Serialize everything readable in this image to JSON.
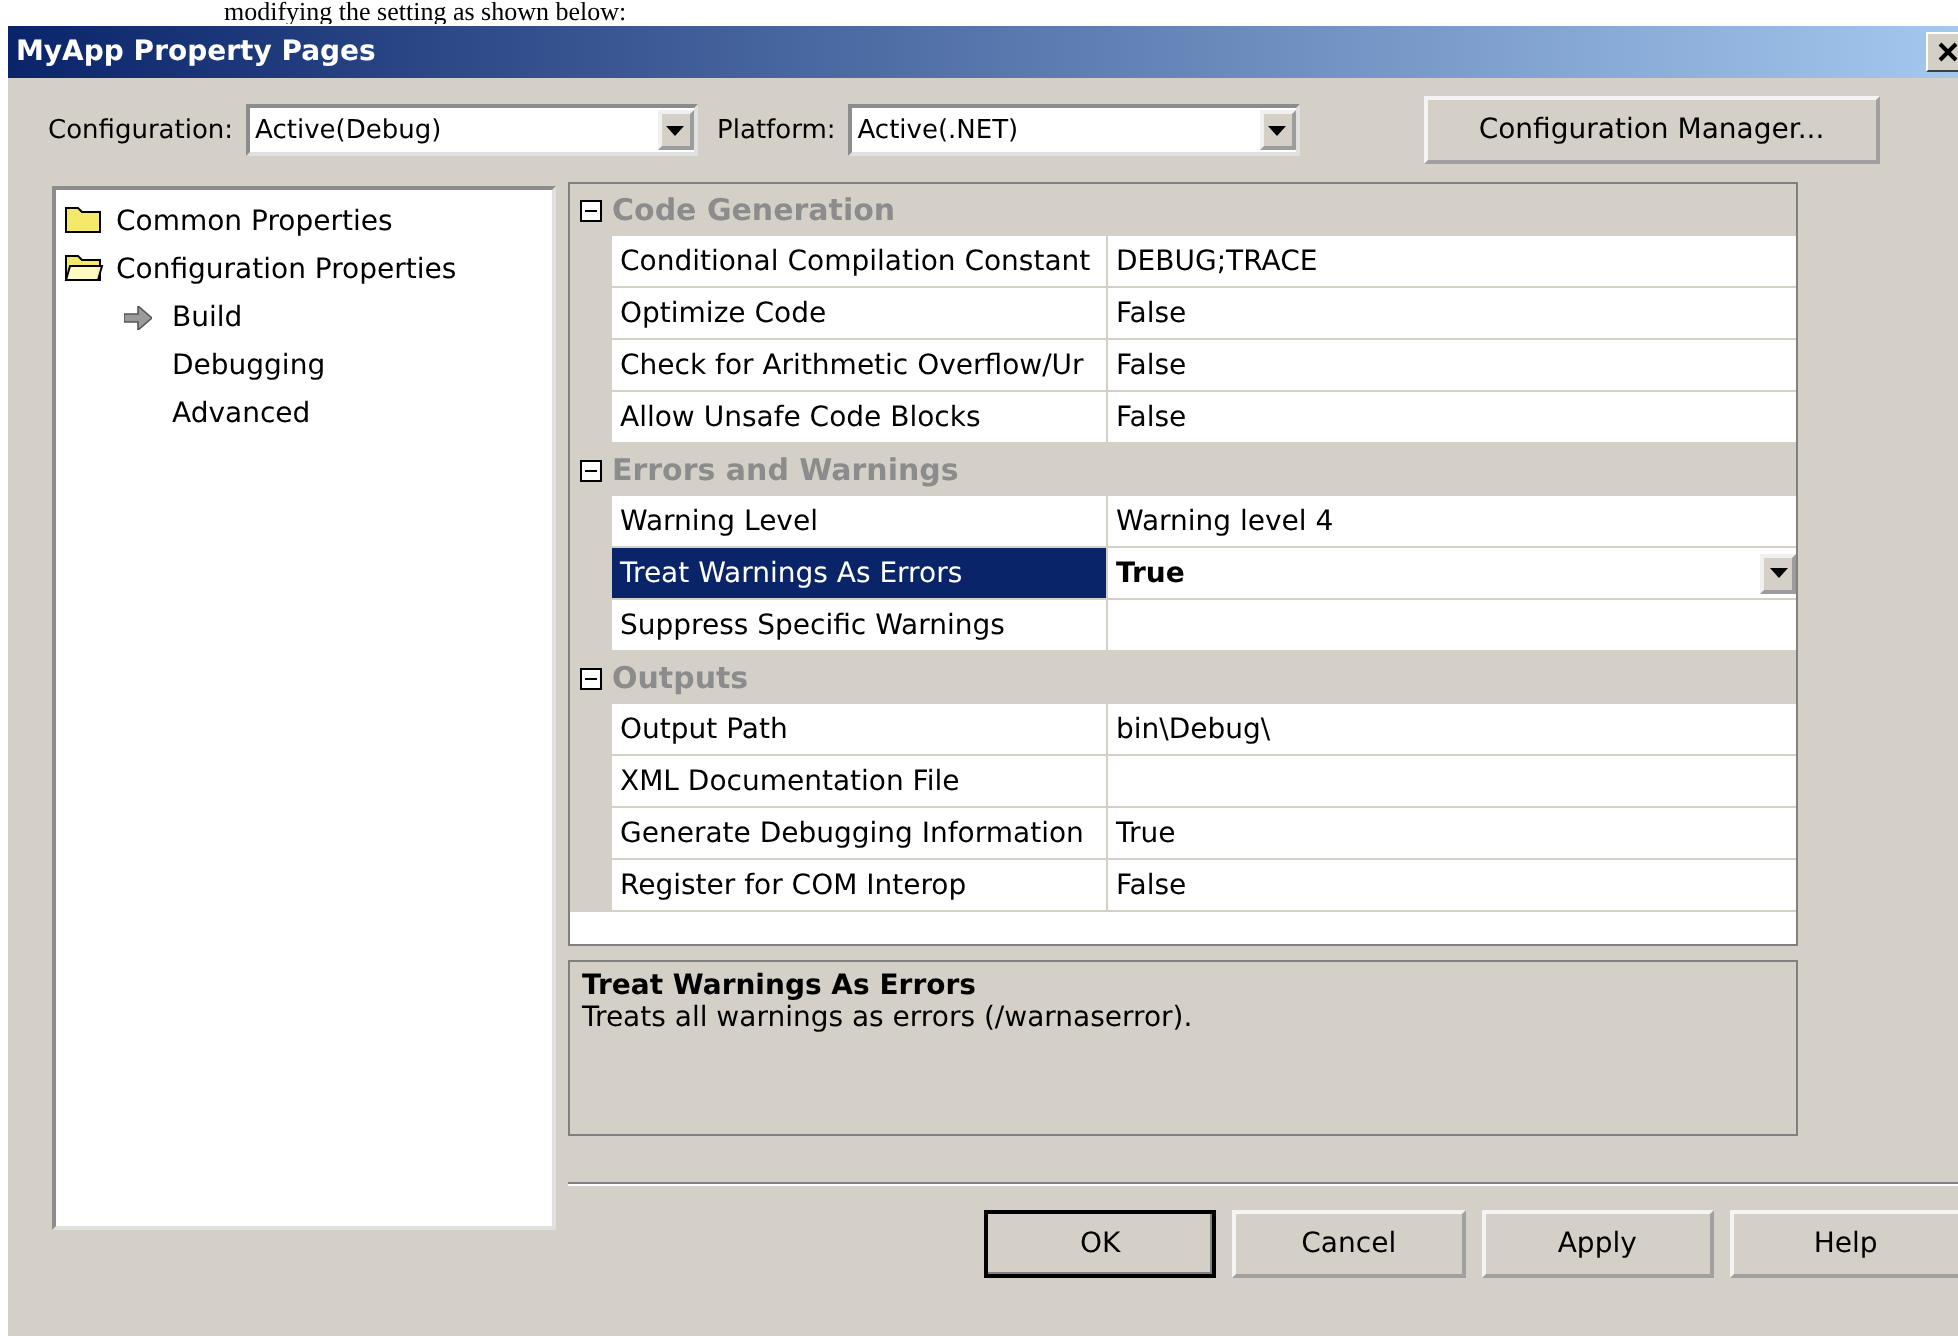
{
  "caption": "modifying the setting as shown below:",
  "window": {
    "title": "MyApp Property Pages"
  },
  "configuration": {
    "label": "Configuration:",
    "value": "Active(Debug)"
  },
  "platform": {
    "label": "Platform:",
    "value": "Active(.NET)"
  },
  "config_manager_button": "Configuration Manager...",
  "tree": [
    {
      "label": "Common Properties",
      "expanded": false
    },
    {
      "label": "Configuration Properties",
      "expanded": true,
      "children": [
        {
          "label": "Build",
          "selected": true
        },
        {
          "label": "Debugging",
          "selected": false
        },
        {
          "label": "Advanced",
          "selected": false
        }
      ]
    }
  ],
  "property_grid": [
    {
      "category": "Code Generation",
      "expanded": true,
      "properties": [
        {
          "name": "Conditional Compilation Constant",
          "value": "DEBUG;TRACE",
          "selected": false,
          "modified": false
        },
        {
          "name": "Optimize Code",
          "value": "False",
          "selected": false,
          "modified": false
        },
        {
          "name": "Check for Arithmetic Overflow/Ur",
          "value": "False",
          "selected": false,
          "modified": false
        },
        {
          "name": "Allow Unsafe Code Blocks",
          "value": "False",
          "selected": false,
          "modified": false
        }
      ]
    },
    {
      "category": "Errors and Warnings",
      "expanded": true,
      "properties": [
        {
          "name": "Warning Level",
          "value": "Warning level 4",
          "selected": false,
          "modified": false
        },
        {
          "name": "Treat Warnings As Errors",
          "value": "True",
          "selected": true,
          "modified": true
        },
        {
          "name": "Suppress Specific Warnings",
          "selected": false,
          "modified": false
        }
      ]
    },
    {
      "category": "Outputs",
      "expanded": true,
      "properties": [
        {
          "name": "Output Path",
          "value": "bin\\Debug\\",
          "selected": false,
          "modified": false
        },
        {
          "name": "XML Documentation File",
          "selected": false,
          "modified": false
        },
        {
          "name": "Generate Debugging Information",
          "value": "True",
          "selected": false,
          "modified": false
        },
        {
          "name": "Register for COM Interop",
          "value": "False",
          "selected": false,
          "modified": false
        }
      ]
    }
  ],
  "description": {
    "title": "Treat Warnings As Errors",
    "text": "Treats all warnings as errors (/warnaserror)."
  },
  "buttons": [
    "OK",
    "Cancel",
    "Apply",
    "Help"
  ]
}
